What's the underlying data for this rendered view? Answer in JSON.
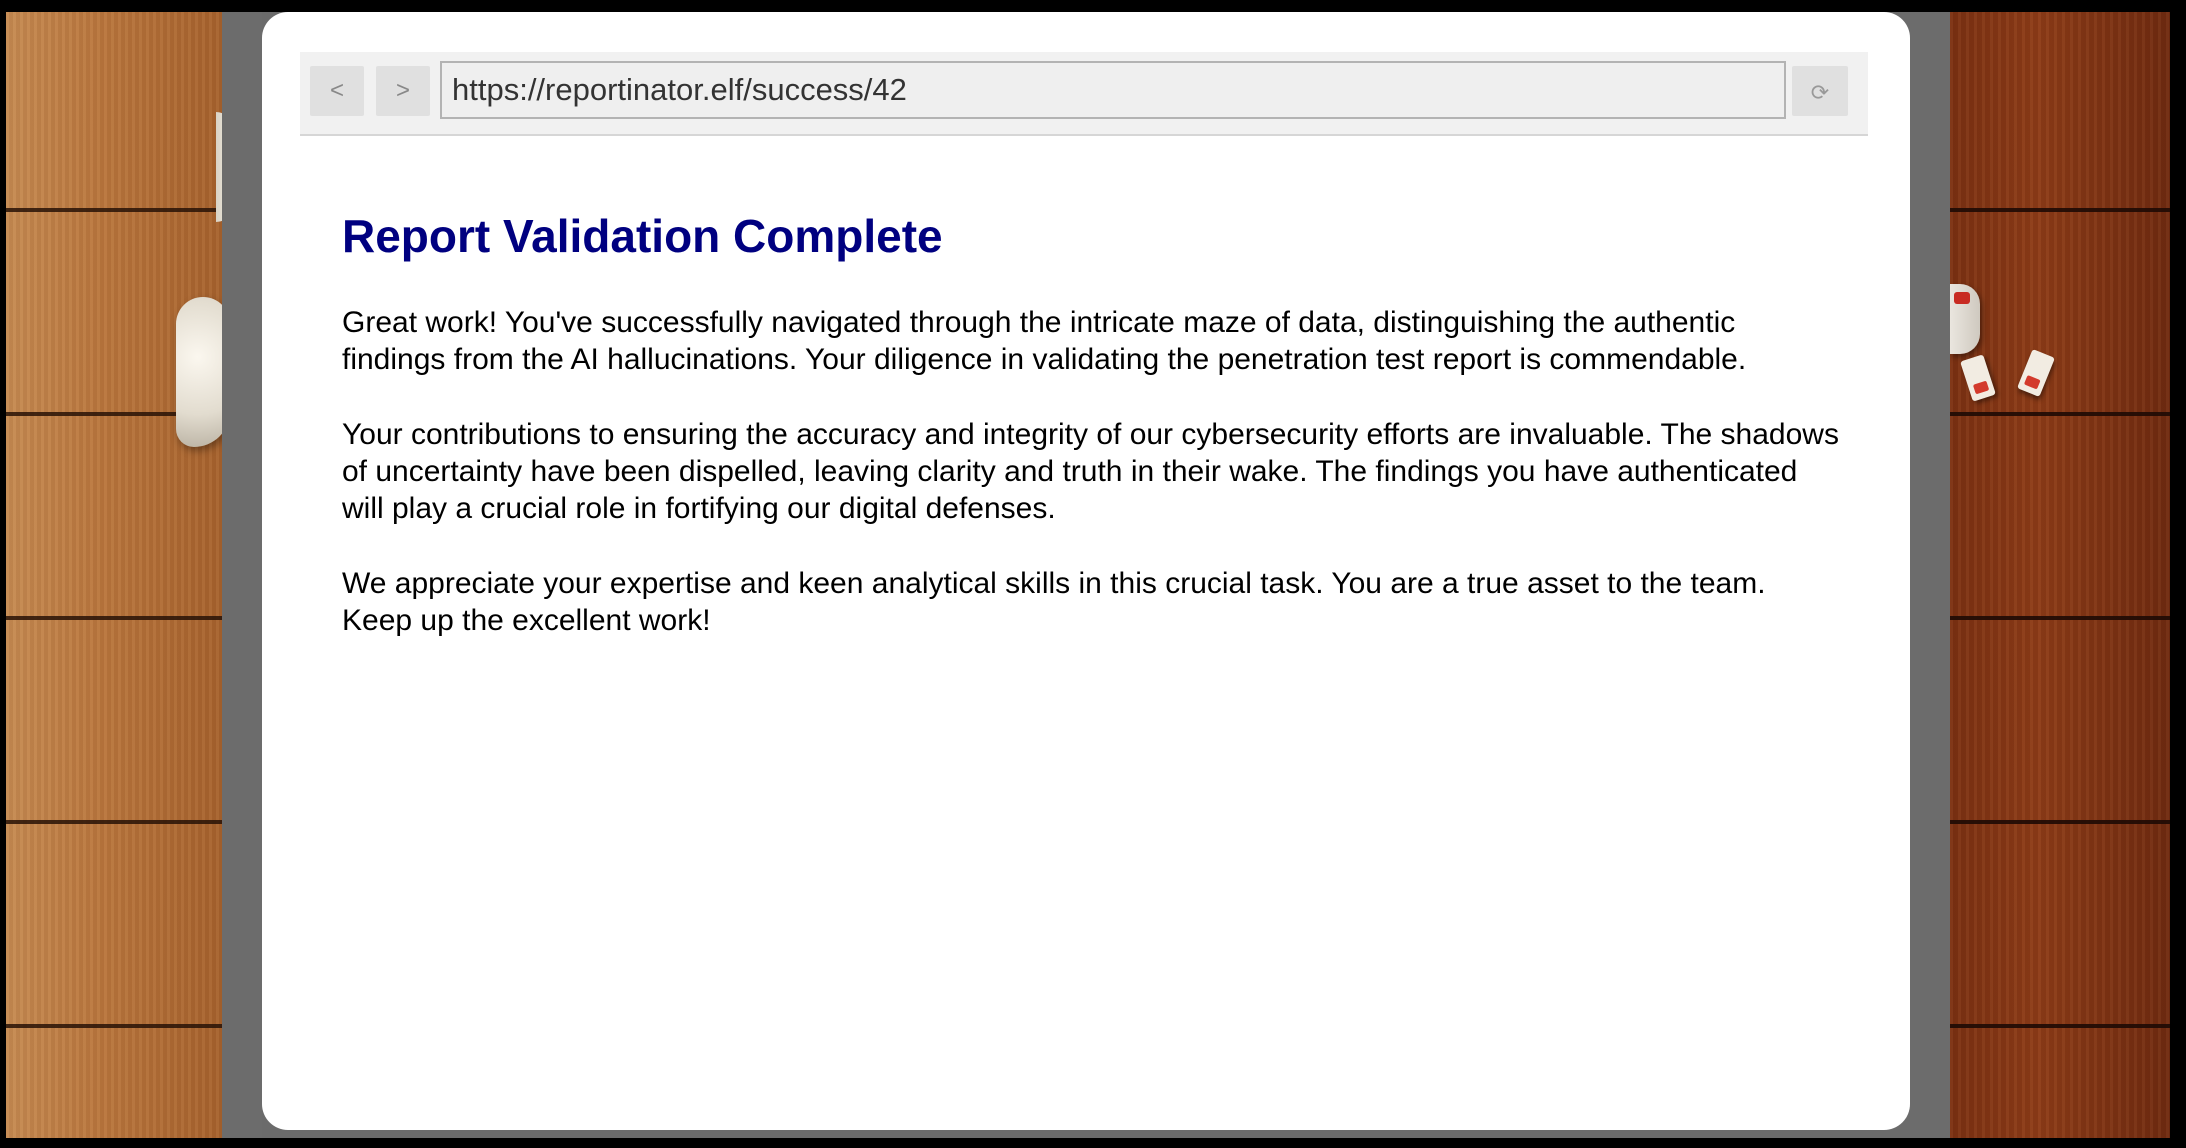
{
  "browser": {
    "back_label": "<",
    "forward_label": ">",
    "url": "https://reportinator.elf/success/42",
    "reload_label": "⟳"
  },
  "page": {
    "title": "Report Validation Complete",
    "paragraphs": [
      "Great work! You've successfully navigated through the intricate maze of data, distinguishing the authentic findings from the AI hallucinations. Your diligence in validating the penetration test report is commendable.",
      "Your contributions to ensuring the accuracy and integrity of our cybersecurity efforts are invaluable. The shadows of uncertainty have been dispelled, leaving clarity and truth in their wake. The findings you have authenticated will play a crucial role in fortifying our digital defenses.",
      "We appreciate your expertise and keen analytical skills in this crucial task. You are a true asset to the team. Keep up the excellent work!"
    ]
  },
  "colors": {
    "title": "#000080",
    "page_background": "#ffffff",
    "backdrop_gray": "#6c6c6c"
  },
  "icons": {
    "back": "chevron-left-icon",
    "forward": "chevron-right-icon",
    "reload": "reload-icon"
  }
}
